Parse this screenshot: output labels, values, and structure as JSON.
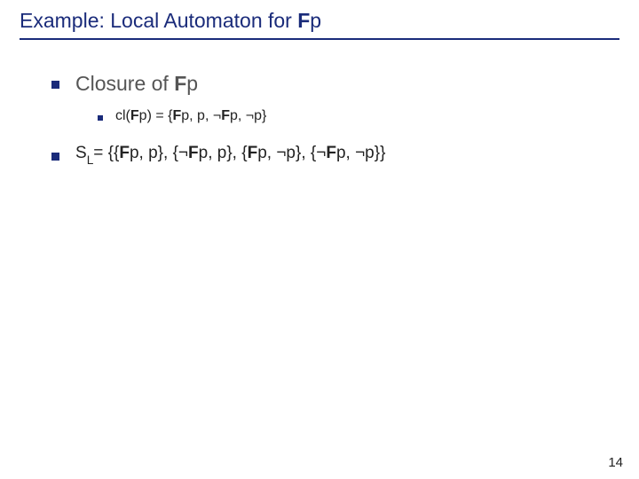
{
  "title": {
    "prefix": "Example: Local Automaton for ",
    "fp_bold": "F",
    "fp_rest": "p"
  },
  "closure": {
    "heading_prefix": "Closure of ",
    "heading_fp_bold": "F",
    "heading_fp_rest": "p",
    "line_a": "cl(",
    "line_b_bold": "F",
    "line_c": "p) = {",
    "line_d_bold": "F",
    "line_e": "p, p, ¬",
    "line_f_bold": "F",
    "line_g": "p, ¬p}"
  },
  "sl": {
    "s": "S",
    "sub": "L",
    "eq": "= {{",
    "f1": "F",
    "t1": "p, p}, {¬",
    "f2": "F",
    "t2": "p, p}, {",
    "f3": "F",
    "t3": "p, ¬p}, {¬",
    "f4": "F",
    "t4": "p, ¬p}}"
  },
  "page_number": "14"
}
